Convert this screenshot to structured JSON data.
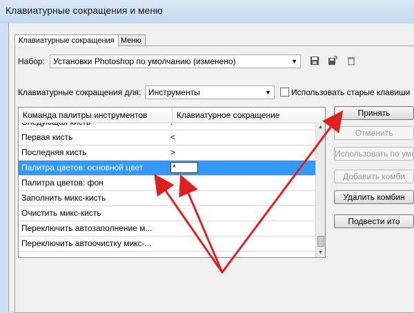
{
  "window": {
    "title": "Клавиатурные сокращения и меню"
  },
  "tabs": [
    {
      "label": "Клавиатурные сокращения",
      "active": true
    },
    {
      "label": "Меню",
      "active": false
    }
  ],
  "set": {
    "label": "Набор:",
    "value": "Установки Photoshop по умолчанию (изменено)"
  },
  "shortcuts_for": {
    "label": "Клавиатурные сокращения для:",
    "value": "Инструменты"
  },
  "legacy_checkbox": {
    "label": "Использовать старые клавиши",
    "checked": false
  },
  "table": {
    "headers": [
      "Команда палитры инструментов",
      "Клавиатурное сокращение"
    ],
    "rows": [
      {
        "command": "Следующая кисть",
        "shortcut": ".",
        "selected": false
      },
      {
        "command": "Первая кисть",
        "shortcut": "<",
        "selected": false
      },
      {
        "command": "Последняя кисть",
        "shortcut": ">",
        "selected": false
      },
      {
        "command": "Палитра цветов: основной цвет",
        "shortcut": "*",
        "selected": true
      },
      {
        "command": "Палитра цветов: фон",
        "shortcut": "",
        "selected": false
      },
      {
        "command": "Заполнить микс-кисть",
        "shortcut": "",
        "selected": false
      },
      {
        "command": "Очистить микс-кисть",
        "shortcut": "",
        "selected": false
      },
      {
        "command": "Переключить автозаполнение м...",
        "shortcut": "",
        "selected": false
      },
      {
        "command": "Переключить автоочистку микс-...",
        "shortcut": "",
        "selected": false
      }
    ]
  },
  "buttons": {
    "accept": "Принять",
    "cancel": "Отменить",
    "use_default": "Использовать по умо",
    "add_shortcut": "Добавить комби",
    "delete_shortcut": "Удалить комбин",
    "summarize": "Подвести ито"
  },
  "icons": [
    "save-icon",
    "save-as-icon",
    "delete-icon"
  ],
  "colors": {
    "selection": "#3399ff",
    "arrow": "#e02020"
  }
}
